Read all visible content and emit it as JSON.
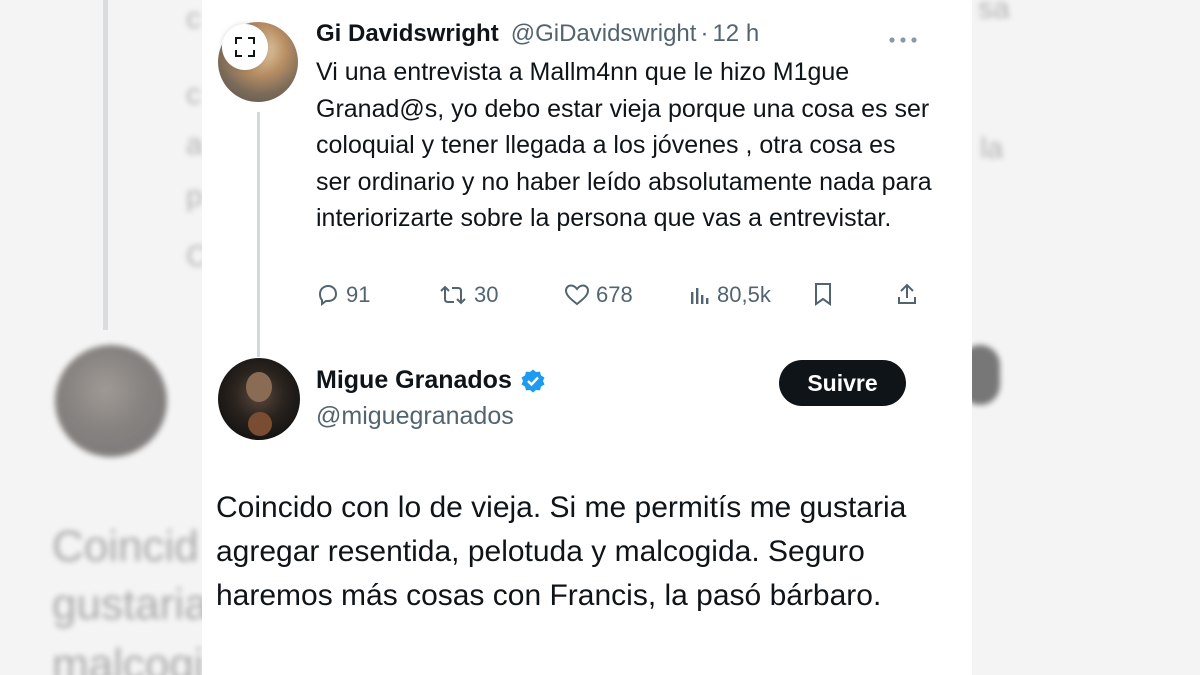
{
  "background": {
    "big_text_lines": [
      "Coincid",
      "gustaria",
      "malcogi"
    ],
    "left_fragments": [
      "c",
      "c",
      "a",
      "p",
      "C"
    ],
    "right_fragments": [
      "sa",
      "la"
    ]
  },
  "tweet_parent": {
    "name": "Gi Davidswright",
    "handle": "@GiDavidswright",
    "separator": "·",
    "time": "12 h",
    "text": "Vi una entrevista a Mallm4nn que le hizo M1gue Granad@s, yo debo estar vieja porque una cosa es ser coloquial y tener llegada a los jóvenes , otra cosa es ser ordinario y no haber leído absolutamente nada para interiorizarte sobre la persona que vas a entrevistar.",
    "actions": {
      "replies": "91",
      "retweets": "30",
      "likes": "678",
      "views": "80,5k"
    }
  },
  "tweet_reply": {
    "name": "Migue Granados",
    "handle": "@miguegranados",
    "follow_label": "Suivre",
    "text": "Coincido con lo de vieja. Si me permitís me gustaria agregar resentida, pelotuda y malcogida. Seguro haremos más cosas con Francis, la pasó bárbaro."
  },
  "colors": {
    "text": "#0f1419",
    "secondary": "#536471",
    "verified": "#1d9bf0",
    "thread_line": "#cfd9de",
    "button_bg": "#0f1419"
  },
  "icons": [
    "expand-icon",
    "more-icon",
    "reply-icon",
    "retweet-icon",
    "like-icon",
    "views-icon",
    "bookmark-icon",
    "share-icon",
    "verified-badge-icon"
  ]
}
